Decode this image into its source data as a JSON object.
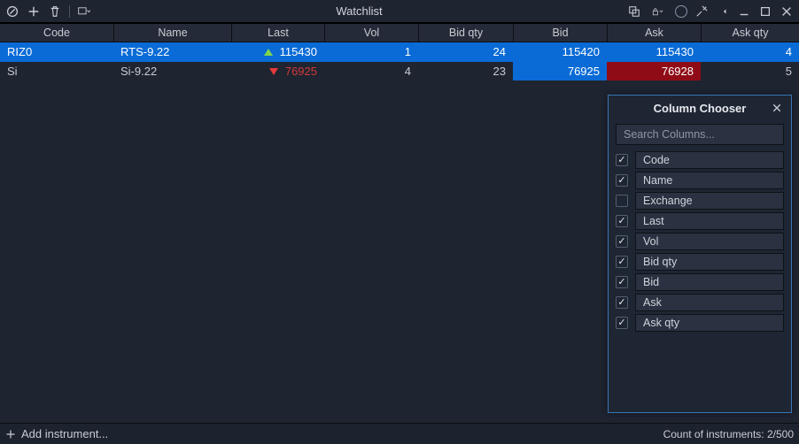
{
  "title": "Watchlist",
  "columns": {
    "code": "Code",
    "name": "Name",
    "last": "Last",
    "vol": "Vol",
    "bidqty": "Bid qty",
    "bid": "Bid",
    "ask": "Ask",
    "askqty": "Ask qty"
  },
  "rows": [
    {
      "selected": true,
      "code": "RIZ0",
      "name": "RTS-9.22",
      "last_dir": "up",
      "last": "115430",
      "vol": "1",
      "bidqty": "24",
      "bid": "115420",
      "ask": "115430",
      "askqty": "4"
    },
    {
      "selected": false,
      "code": "Si",
      "name": "Si-9.22",
      "last_dir": "down",
      "last": "76925",
      "vol": "4",
      "bidqty": "23",
      "bid": "76925",
      "ask": "76928",
      "askqty": "5"
    }
  ],
  "column_chooser": {
    "title": "Column Chooser",
    "search_placeholder": "Search Columns...",
    "items": [
      {
        "label": "Code",
        "checked": true
      },
      {
        "label": "Name",
        "checked": true
      },
      {
        "label": "Exchange",
        "checked": false
      },
      {
        "label": "Last",
        "checked": true
      },
      {
        "label": "Vol",
        "checked": true
      },
      {
        "label": "Bid qty",
        "checked": true
      },
      {
        "label": "Bid",
        "checked": true
      },
      {
        "label": "Ask",
        "checked": true
      },
      {
        "label": "Ask qty",
        "checked": true
      }
    ]
  },
  "footer": {
    "add_instrument": "Add instrument...",
    "status": "Count of instruments: 2/500"
  }
}
